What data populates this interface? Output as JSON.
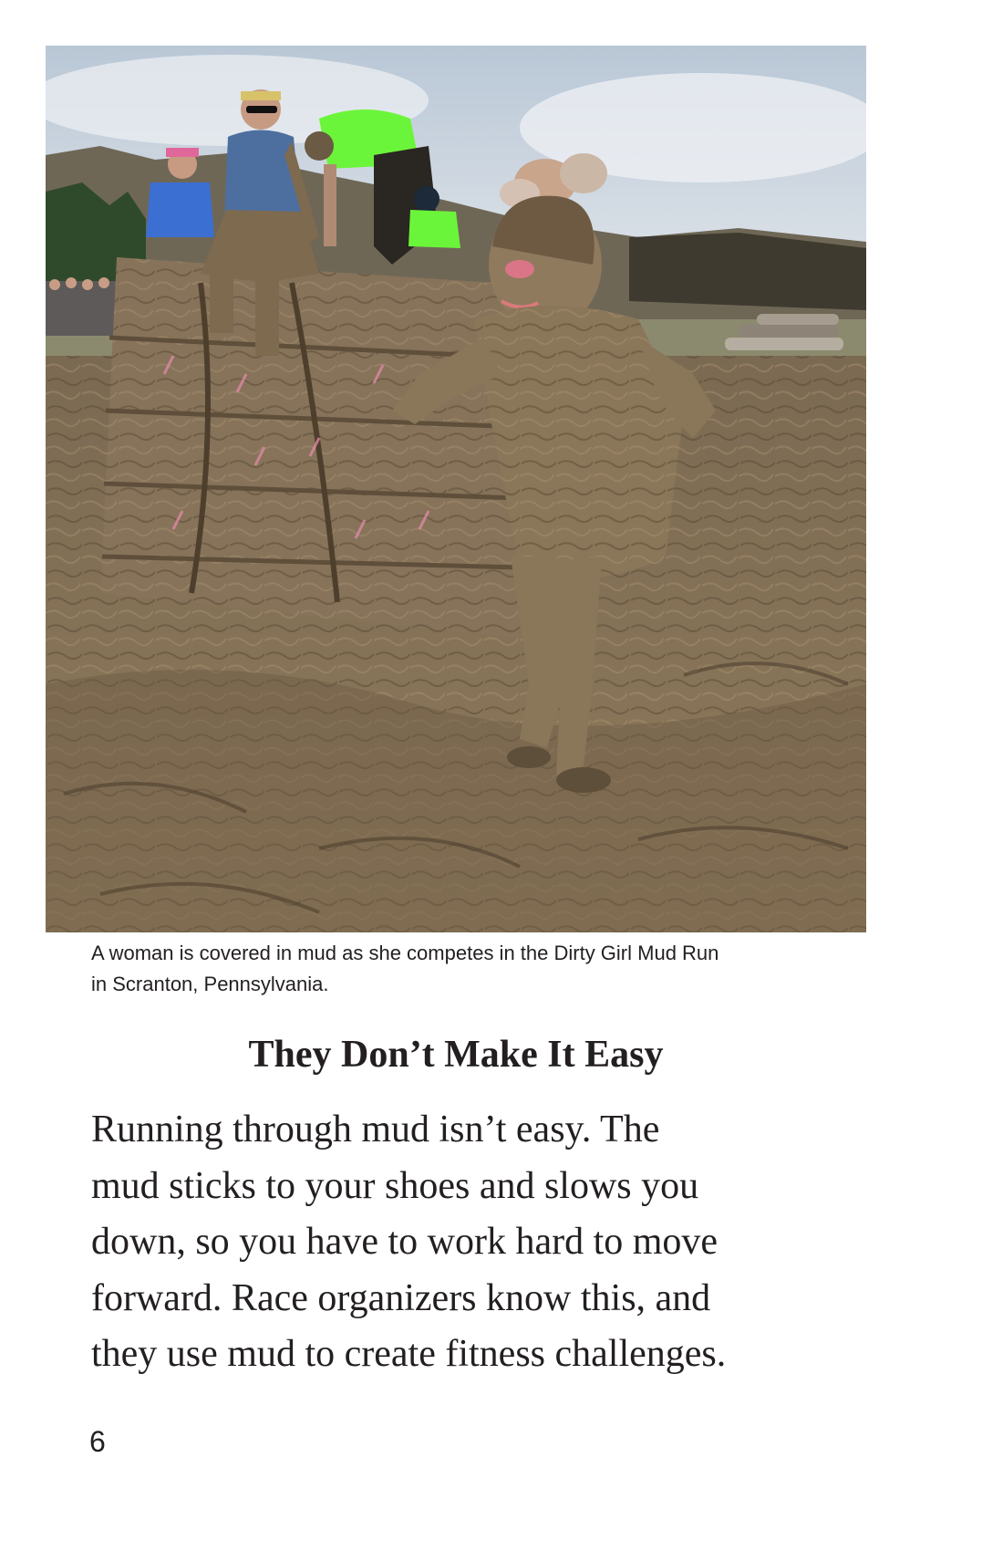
{
  "caption": {
    "line1": "A woman is covered in mud as she competes in the Dirty Girl Mud Run",
    "line2": "in Scranton, Pennsylvania."
  },
  "heading": "They Don’t Make It Easy",
  "body_lines": [
    "Running through mud isn’t easy. The",
    "mud sticks to your shoes and slows you",
    "down, so you have to work hard to move",
    "forward. Race organizers know this, and",
    "they use mud to create fitness challenges."
  ],
  "page_number": "6",
  "colors": {
    "sky": "#c9d3dd",
    "mud": "#8a7658",
    "dark_mud": "#5e4f3a",
    "text": "#231f20",
    "neon_green": "#6bf53a",
    "shirt_blue": "#4d6fa0",
    "tape_red": "#d8263c"
  }
}
